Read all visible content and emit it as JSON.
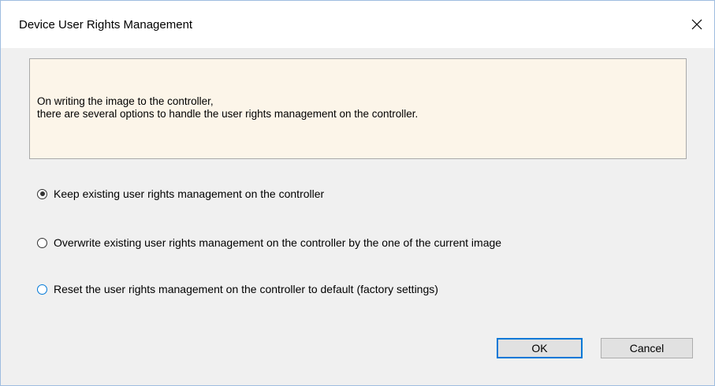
{
  "window": {
    "title": "Device User Rights Management",
    "close_icon": "close-x-icon"
  },
  "info": {
    "line1": "On writing the image to the controller,",
    "line2": "there are several options to handle the user rights management on the controller."
  },
  "options": [
    {
      "label": "Keep existing user rights management on the controller",
      "selected": true
    },
    {
      "label": "Overwrite existing user rights management on the controller by the one of the current image",
      "selected": false
    },
    {
      "label": "Reset the user rights management on the controller to default (factory settings)",
      "selected": false
    }
  ],
  "buttons": {
    "ok_label": "OK",
    "cancel_label": "Cancel"
  },
  "colors": {
    "info_background": "#fcf5e9",
    "focus_accent": "#0078d7"
  }
}
